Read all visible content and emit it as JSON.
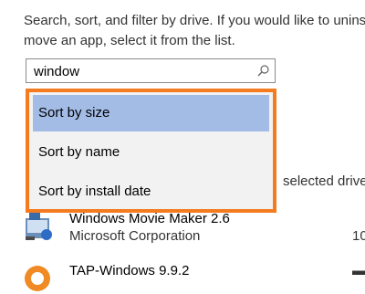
{
  "description": {
    "line1": "Search, sort, and filter by drive. If you would like to unins",
    "line2": "move an app, select it from the list."
  },
  "search": {
    "value": "window",
    "icon": "search-icon"
  },
  "sort_menu": {
    "options": [
      "Sort by size",
      "Sort by name",
      "Sort by install date"
    ],
    "selected": "Sort by size",
    "highlight_color": "#f47b20",
    "selected_bg": "#a3bce6"
  },
  "filter_text": "selected drive",
  "apps": [
    {
      "name": "Windows Movie Maker 2.6",
      "publisher": "Microsoft Corporation",
      "size_fragment": "10",
      "icon": "movie-maker-icon"
    },
    {
      "name": "TAP-Windows 9.9.2",
      "publisher": "",
      "size_fragment": "",
      "icon": "tap-windows-icon"
    }
  ]
}
